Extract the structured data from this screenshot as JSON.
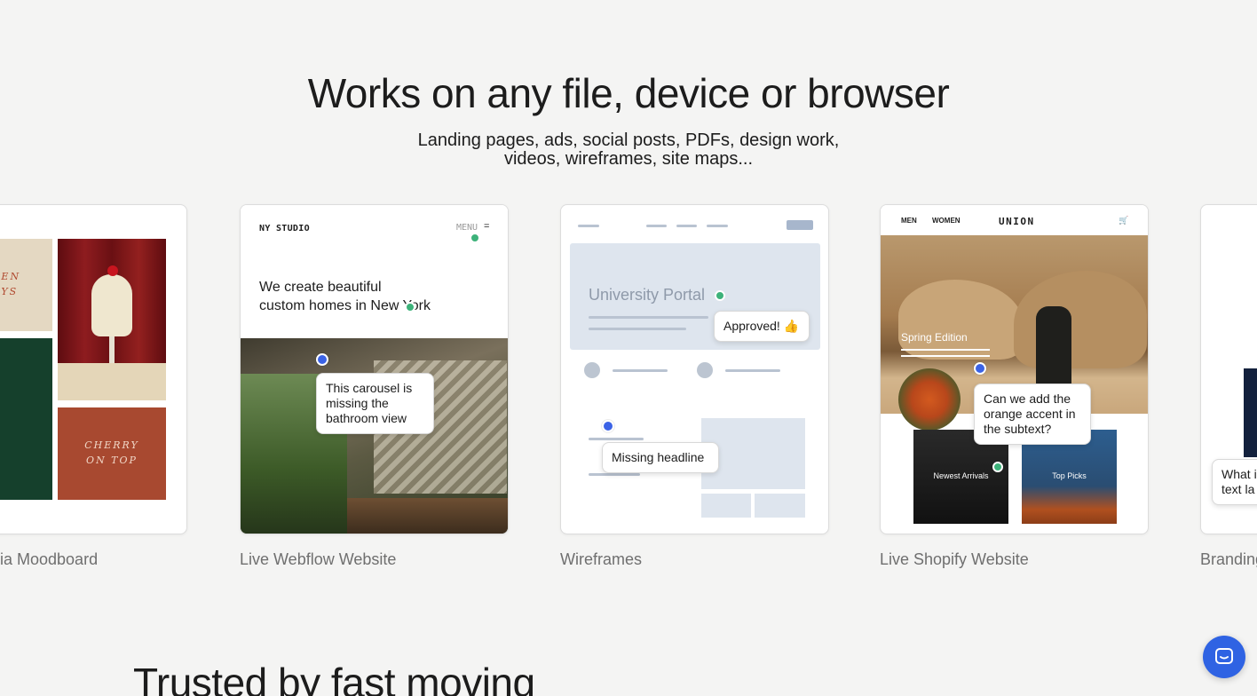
{
  "section": {
    "headline": "Works on any file, device or browser",
    "subline_1": "Landing pages, ads, social posts, PDFs, design work,",
    "subline_2": "videos, wireframes, site maps..."
  },
  "cards": [
    {
      "label": "ia Moodboard",
      "tiles": {
        "open": "OPEN\nDAYS",
        "cherry": "CHERRY\nON TOP"
      }
    },
    {
      "label": "Live Webflow Website",
      "logo": "NY STUDIO",
      "menu": "MENU",
      "menu_icon": "=",
      "hero_line_1": "We create beautiful",
      "hero_line_2": "custom homes in New York",
      "comment": "This carousel is missing the bathroom view"
    },
    {
      "label": "Wireframes",
      "hero_title": "University Portal",
      "comment_approved": "Approved! 👍",
      "comment_missing": "Missing headline"
    },
    {
      "label": "Live Shopify Website",
      "nav_men": "MEN",
      "nav_women": "WOMEN",
      "brand": "UNION",
      "cart_icon": "🛒",
      "hero_tag": "Spring Edition",
      "comment": "Can we add the orange accent in the subtext?",
      "tile_1": "Newest Arrivals",
      "tile_2": "Top Picks"
    },
    {
      "label": "Branding",
      "comment": "What i text la"
    }
  ],
  "trusted": "Trusted by fast moving",
  "chat_icon": "chat-bubble-icon",
  "colors": {
    "accent": "#2f63e3",
    "comment_blue": "#3b63e6",
    "comment_green": "#3db27a"
  }
}
